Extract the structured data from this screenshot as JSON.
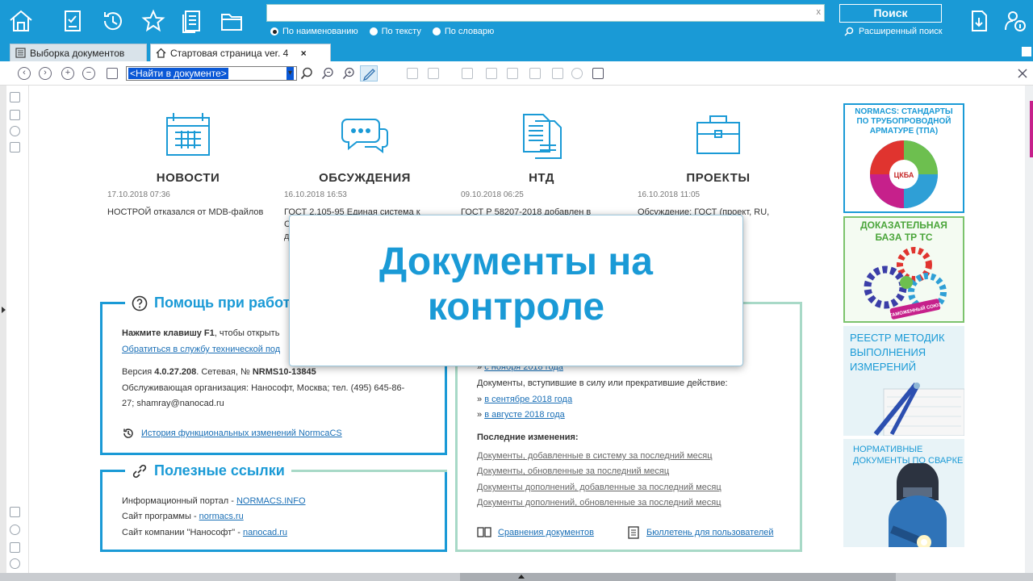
{
  "colors": {
    "brand": "#1a9ad6",
    "accent": "#c6208b"
  },
  "topbar": {
    "icons": [
      "home-icon",
      "checklist-icon",
      "history-icon",
      "star-icon",
      "document-icon",
      "folder-icon"
    ],
    "search": {
      "value": "",
      "clear": "x"
    },
    "radios": [
      {
        "label": "По наименованию",
        "selected": true
      },
      {
        "label": "По тексту",
        "selected": false
      },
      {
        "label": "По словарю",
        "selected": false
      }
    ],
    "search_button": "Поиск",
    "advanced_search": "Расширенный поиск",
    "right_icons": [
      "export-icon",
      "user-info-icon"
    ]
  },
  "tabs": [
    {
      "label": "Выборка документов",
      "active": false
    },
    {
      "label": "Стартовая страница ver. 4",
      "active": true,
      "close": "×"
    }
  ],
  "toolbar": {
    "find_placeholder": "<Найти в документе>"
  },
  "cards": [
    {
      "title": "НОВОСТИ",
      "date": "17.10.2018 07:36",
      "text": "НОСТРОЙ отказался от MDB-файлов",
      "icon": "calendar-icon"
    },
    {
      "title": "ОБСУЖДЕНИЯ",
      "date": "16.10.2018 16:53",
      "text": "ГОСТ 2.105-95 Единая система к\nС\nд",
      "icon": "chat-icon"
    },
    {
      "title": "НТД",
      "date": "09.10.2018 06:25",
      "text": "ГОСТ Р 58207-2018 добавлен в",
      "icon": "documents-icon"
    },
    {
      "title": "ПРОЕКТЫ",
      "date": "16.10.2018 11:05",
      "text": "Обсуждение: ГОСТ (проект, RU,\nрукции\nжарные\nспытаний на",
      "icon": "briefcase-icon"
    }
  ],
  "help_panel": {
    "title": "Помощь при работе",
    "f1_bold": "Нажмите клавишу F1",
    "f1_rest": ", чтобы открыть",
    "support_link": "Обратиться в службу технической под",
    "version_prefix": "Версия ",
    "version": "4.0.27.208",
    "version_mid": ". Сетевая, № ",
    "serial": "NRMS10-13845",
    "org": "Обслуживающая организация: Нанософт, Москва; тел. (495) 645-86-",
    "org2": "27; shamray@nanocad.ru",
    "history_link": "История функциональных изменений NormcaCS"
  },
  "links_panel": {
    "title": "Полезные ссылки",
    "rows": [
      {
        "prefix": "Информационный портал - ",
        "link": "NORMACS.INFO"
      },
      {
        "prefix": "Сайт программы - ",
        "link": "normacs.ru"
      },
      {
        "prefix": "Сайт компании \"Нанософт\" - ",
        "link": "nanocad.ru"
      }
    ]
  },
  "docs_panel": {
    "partial_link": "с ноября 2018 года",
    "effective_label": "Документы, вступившие в силу или прекратившие действие:",
    "month_links": [
      "в сентябре 2018 года",
      "в августе 2018 года"
    ],
    "recent_title": "Последние изменения:",
    "recent_links": [
      "Документы, добавленные в систему за последний месяц",
      "Документы, обновленные за последний месяц",
      "Документы дополнений, добавленные за последний месяц",
      "Документы дополнений, обновленные за последний месяц"
    ],
    "compare_link": "Сравнения документов",
    "bulletin_link": "Бюллетень для пользователей"
  },
  "banners": [
    {
      "text": "NORMACS: СТАНДАРТЫ ПО ТРУБОПРОВОДНОЙ АРМАТУРЕ (ТПА)",
      "logo": "ЦКБА"
    },
    {
      "text": "ДОКАЗАТЕЛЬНАЯ БАЗА ТР ТС",
      "badge": "ТАМОЖЕННЫЙ СОЮЗ"
    },
    {
      "text": "РЕЕСТР МЕТОДИК ВЫПОЛНЕНИЯ ИЗМЕРЕНИЙ"
    },
    {
      "text": "НОРМАТИВНЫЕ ДОКУМЕНТЫ ПО СВАРКЕ"
    }
  ],
  "modal": {
    "title": "Документы на контроле"
  }
}
